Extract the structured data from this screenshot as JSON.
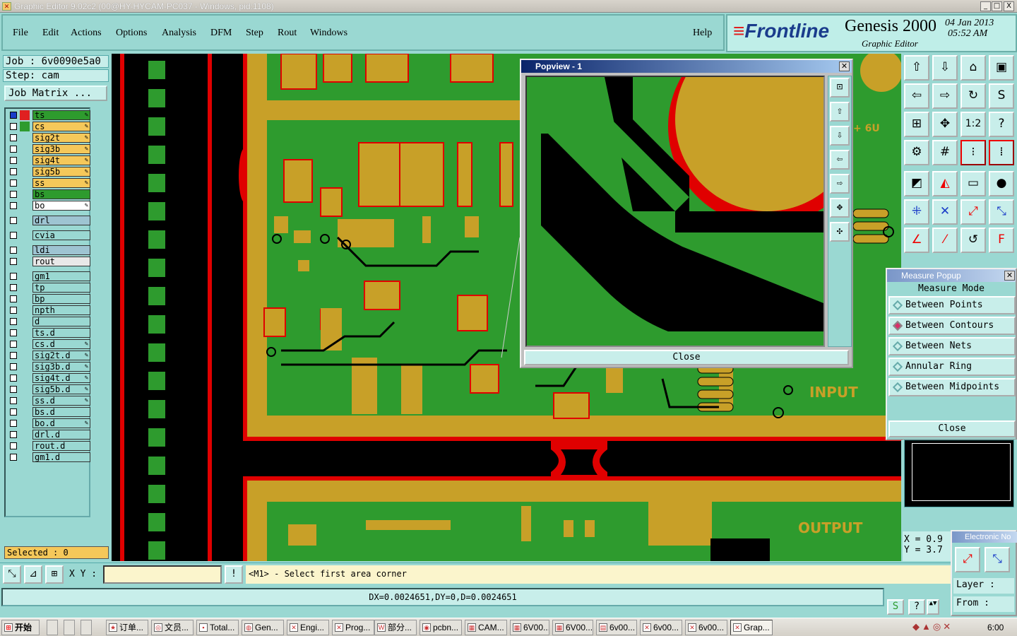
{
  "window": {
    "title": "Graphic Editor 9.02c2 (00@HY-HYCAM-PC037 - Windows, pid:1108)",
    "min": "_",
    "max": "□",
    "close": "X"
  },
  "menu": {
    "items": [
      "File",
      "Edit",
      "Actions",
      "Options",
      "Analysis",
      "DFM",
      "Step",
      "Rout",
      "Windows"
    ],
    "help": "Help"
  },
  "brand": {
    "logo_a": "Front",
    "logo_b": "line",
    "product": "Genesis 2000",
    "subtitle": "Graphic Editor",
    "date": "04 Jan 2013",
    "time": "05:52 AM"
  },
  "job": {
    "job": "Job : 6v0090e5a0",
    "step": "Step: cam",
    "matrix_button": "Job Matrix ..."
  },
  "layers": [
    {
      "name": "ts",
      "color": "#2e9b2e",
      "swatch": "#e02020",
      "pen": true
    },
    {
      "name": "cs",
      "color": "#f5c85a",
      "swatch": "#2e9b2e",
      "pen": true
    },
    {
      "name": "sig2t",
      "color": "#f5c85a",
      "swatch": "",
      "pen": true
    },
    {
      "name": "sig3b",
      "color": "#f5c85a",
      "swatch": "",
      "pen": true
    },
    {
      "name": "sig4t",
      "color": "#f5c85a",
      "swatch": "",
      "pen": true
    },
    {
      "name": "sig5b",
      "color": "#f5c85a",
      "swatch": "",
      "pen": true
    },
    {
      "name": "ss",
      "color": "#f5c85a",
      "swatch": "",
      "pen": true
    },
    {
      "name": "bs",
      "color": "#2e9b2e",
      "swatch": "",
      "pen": false
    },
    {
      "name": "bo",
      "color": "#ffffff",
      "swatch": "",
      "pen": true
    },
    {
      "name": "drl",
      "color": "#9ec4d2",
      "swatch": "",
      "pen": false
    },
    {
      "name": "cvia",
      "color": "#9ad8d2",
      "swatch": "",
      "pen": false
    },
    {
      "name": "ldi",
      "color": "#9ec4d2",
      "swatch": "",
      "pen": false
    },
    {
      "name": "rout",
      "color": "#e8e8e8",
      "swatch": "",
      "pen": false
    },
    {
      "name": "gm1",
      "color": "#9ad8d2",
      "swatch": "",
      "pen": false
    },
    {
      "name": "tp",
      "color": "#9ad8d2",
      "swatch": "",
      "pen": false
    },
    {
      "name": "bp",
      "color": "#9ad8d2",
      "swatch": "",
      "pen": false
    },
    {
      "name": "npth",
      "color": "#9ad8d2",
      "swatch": "",
      "pen": false
    },
    {
      "name": "d",
      "color": "#9ad8d2",
      "swatch": "",
      "pen": false
    },
    {
      "name": "ts.d",
      "color": "#9ad8d2",
      "swatch": "",
      "pen": false
    },
    {
      "name": "cs.d",
      "color": "#9ad8d2",
      "swatch": "",
      "pen": true
    },
    {
      "name": "sig2t.d",
      "color": "#9ad8d2",
      "swatch": "",
      "pen": true
    },
    {
      "name": "sig3b.d",
      "color": "#9ad8d2",
      "swatch": "",
      "pen": true
    },
    {
      "name": "sig4t.d",
      "color": "#9ad8d2",
      "swatch": "",
      "pen": true
    },
    {
      "name": "sig5b.d",
      "color": "#9ad8d2",
      "swatch": "",
      "pen": true
    },
    {
      "name": "ss.d",
      "color": "#9ad8d2",
      "swatch": "",
      "pen": true
    },
    {
      "name": "bs.d",
      "color": "#9ad8d2",
      "swatch": "",
      "pen": false
    },
    {
      "name": "bo.d",
      "color": "#9ad8d2",
      "swatch": "",
      "pen": true
    },
    {
      "name": "drl.d",
      "color": "#9ad8d2",
      "swatch": "",
      "pen": false
    },
    {
      "name": "rout.d",
      "color": "#9ad8d2",
      "swatch": "",
      "pen": false
    },
    {
      "name": "gm1.d",
      "color": "#9ad8d2",
      "swatch": "",
      "pen": false
    }
  ],
  "selected": "Selected : 0",
  "board_labels": {
    "input": "INPUT",
    "output": "OUTPUT",
    "silk": "+ 6U"
  },
  "popview": {
    "title": "Popview - 1",
    "close": "Close"
  },
  "measure": {
    "title": "Measure Popup",
    "mode": "Measure Mode",
    "options": [
      "Between Points",
      "Between Contours",
      "Between Nets",
      "Annular Ring",
      "Between Midpoints"
    ],
    "selected_index": 1,
    "close": "Close"
  },
  "coords": {
    "x": "X = 0.9",
    "y": "Y = 3.7"
  },
  "electronic": {
    "title": "Electronic No",
    "layer": "Layer :",
    "from": "From :"
  },
  "cmd": {
    "xy_label": "X Y :",
    "xy_value": "",
    "message": "<M1> - Select first area corner"
  },
  "status": "DX=0.0024651,DY=0,D=0.0024651",
  "taskbar": {
    "start": "开始",
    "items": [
      "订单...",
      "文员...",
      "Total...",
      "Gen...",
      "Engi...",
      "Prog...",
      "部分...",
      "pcbn...",
      "CAM...",
      "6V00...",
      "6V00...",
      "6v00...",
      "6v00...",
      "6v00...",
      "Grap..."
    ],
    "clock": "6:00"
  },
  "colors": {
    "board": "#2e9b2e",
    "copper": "#c8a028",
    "outline": "#ff0000",
    "background": "#000000"
  }
}
